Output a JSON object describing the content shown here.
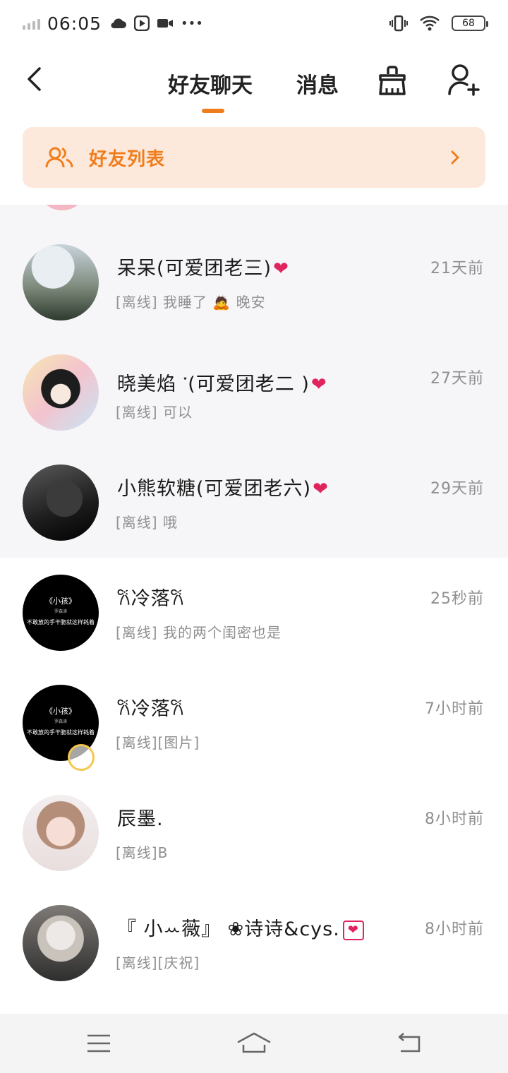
{
  "status_bar": {
    "time": "06:05",
    "battery": "68",
    "more": "•••"
  },
  "header": {
    "tabs": [
      {
        "label": "好友聊天",
        "active": true
      },
      {
        "label": "消息",
        "active": false
      }
    ],
    "accent_color": "#f07d1b"
  },
  "friend_list_banner": {
    "label": "好友列表"
  },
  "chats": [
    {
      "name": "呆呆(可爱团老三)",
      "preview": "[离线] 我睡了 🙇 晚安",
      "time": "21天前"
    },
    {
      "name": "晓美焰 ་(可爱团老二 )",
      "preview": "[离线] 可以",
      "time": "27天前"
    },
    {
      "name": "小熊软糖(可爱团老六)",
      "preview": "[离线] 哦",
      "time": "29天前"
    },
    {
      "name": "𐙚冷落𐙚",
      "preview": "[离线] 我的两个闺密也是",
      "time": "25秒前",
      "avatar_text": [
        "《小孩》",
        "罗森涛",
        "不敢放的手干脆就这样耗着"
      ]
    },
    {
      "name": "𐙚冷落𐙚",
      "preview": "[离线][图片]",
      "time": "7小时前",
      "avatar_text": [
        "《小孩》",
        "罗森涛",
        "不敢放的手干脆就这样耗着"
      ]
    },
    {
      "name": "辰墨.",
      "preview": "[离线]B",
      "time": "8小时前"
    },
    {
      "name": "『 小ꕀ薇』 ❀诗诗&cys.",
      "preview": "[离线][庆祝]",
      "time": "8小时前"
    }
  ],
  "icons": {
    "back": "back-arrow-icon",
    "clean": "broom-icon",
    "add_friend": "add-friend-icon",
    "friends": "friends-icon",
    "heart": "❤"
  }
}
